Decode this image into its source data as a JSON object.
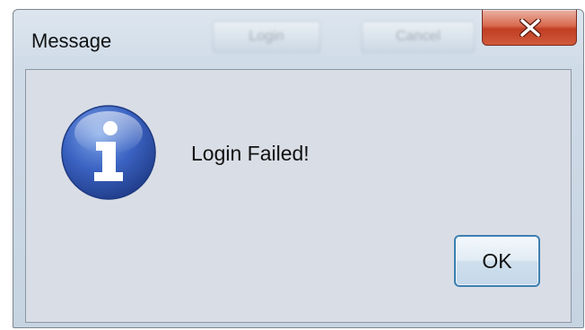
{
  "dialog": {
    "title": "Message",
    "message": "Login Failed!",
    "icon": "info-icon",
    "ok_label": "OK",
    "close_icon": "close-icon"
  },
  "background": {
    "buttons": [
      "Login",
      "Cancel"
    ]
  }
}
